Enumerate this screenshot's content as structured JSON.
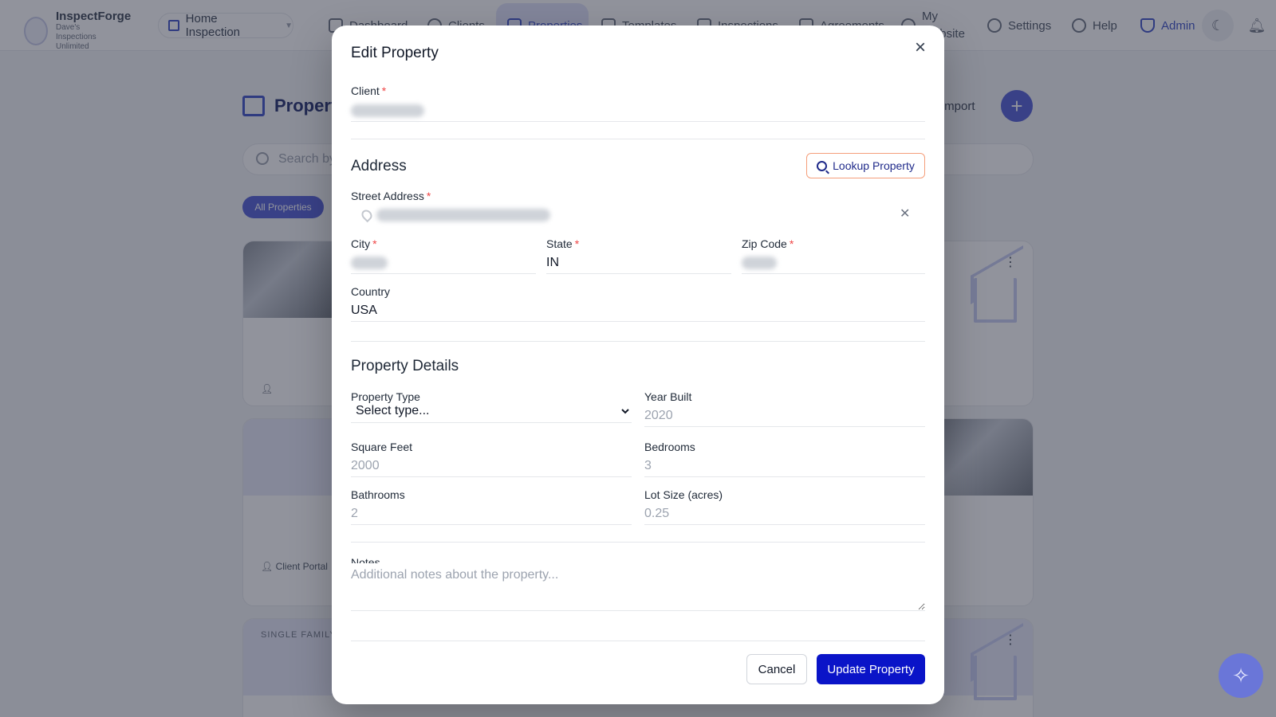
{
  "app": {
    "brand": "InspectForge",
    "company": "Dave's Inspections Unlimited",
    "workspace": "Home Inspection",
    "nav": {
      "dashboard": "Dashboard",
      "clients": "Clients",
      "properties": "Properties",
      "templates": "Templates",
      "inspections": "Inspections",
      "agreements": "Agreements",
      "my_website": "My Website",
      "settings": "Settings",
      "help": "Help",
      "admin": "Admin"
    }
  },
  "background": {
    "page_title": "Properties",
    "import_label": "Import",
    "search_placeholder": "Search by",
    "filter_all": "All Properties",
    "card_tag": "SINGLE FAMILY",
    "client_portal": "Client Portal"
  },
  "modal": {
    "title": "Edit Property",
    "client_label": "Client",
    "address_heading": "Address",
    "lookup_button": "Lookup Property",
    "street_label": "Street Address",
    "city_label": "City",
    "state_label": "State",
    "state_value": "IN",
    "zip_label": "Zip Code",
    "country_label": "Country",
    "country_value": "USA",
    "details_heading": "Property Details",
    "property_type_label": "Property Type",
    "property_type_value": "Select type...",
    "year_built_label": "Year Built",
    "year_built_placeholder": "2020",
    "square_feet_label": "Square Feet",
    "square_feet_placeholder": "2000",
    "bedrooms_label": "Bedrooms",
    "bedrooms_placeholder": "3",
    "bathrooms_label": "Bathrooms",
    "bathrooms_placeholder": "2",
    "lot_size_label": "Lot Size (acres)",
    "lot_size_placeholder": "0.25",
    "notes_label": "Notes",
    "notes_placeholder": "Additional notes about the property...",
    "cancel_button": "Cancel",
    "update_button": "Update Property"
  },
  "required_marker": "*",
  "colors": {
    "primary": "#0a14c8",
    "accent": "#4f5bd5",
    "required": "#ef4444",
    "lookup_border": "#f59e7a"
  }
}
